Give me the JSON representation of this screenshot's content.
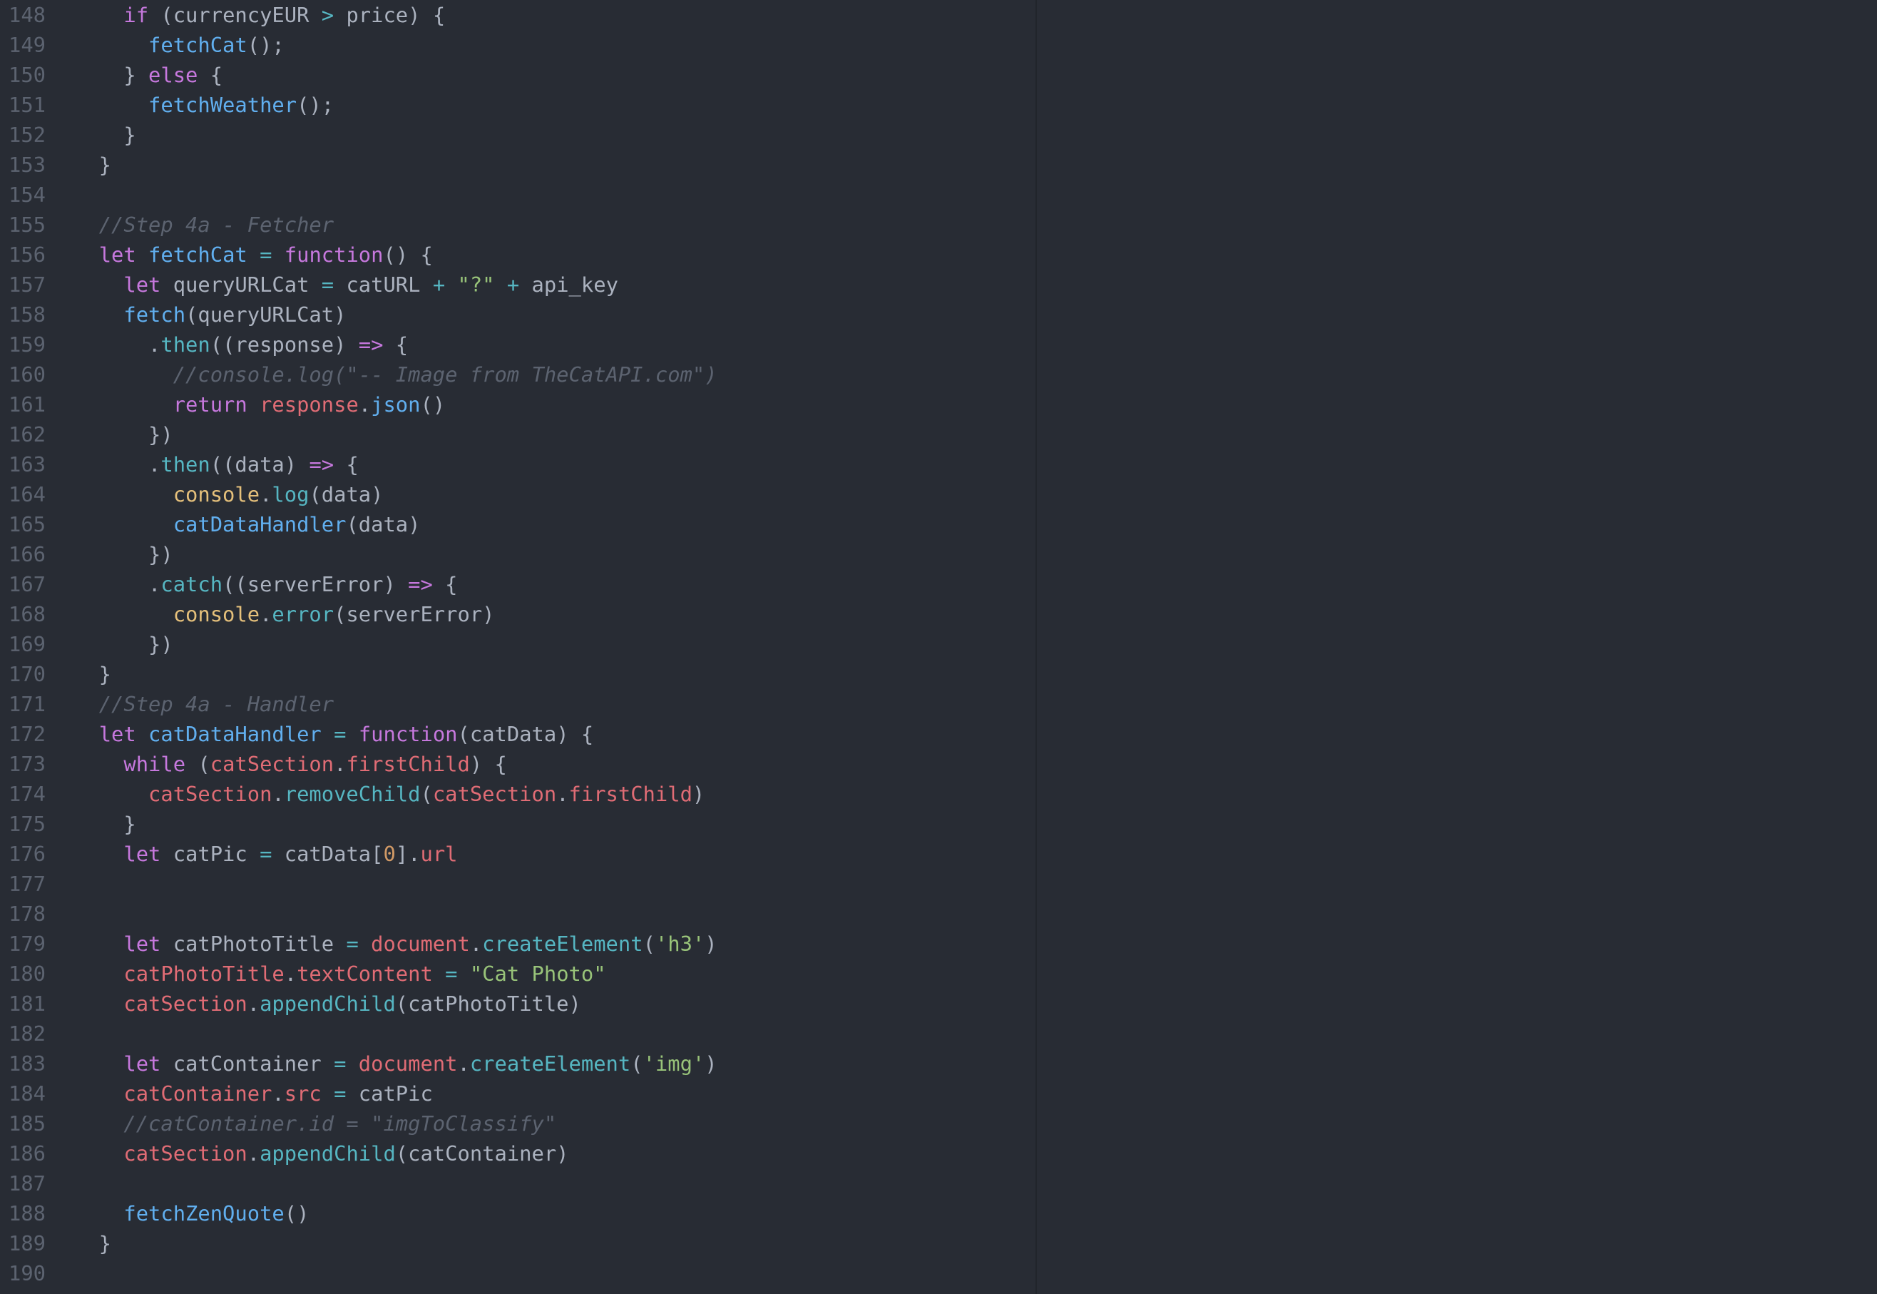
{
  "editor": {
    "lines": [
      {
        "num": "148",
        "tokens": [
          {
            "t": "    "
          },
          {
            "t": "if",
            "c": "kw"
          },
          {
            "t": " (currencyEUR "
          },
          {
            "t": ">",
            "c": "op"
          },
          {
            "t": " price) {"
          }
        ]
      },
      {
        "num": "149",
        "tokens": [
          {
            "t": "      "
          },
          {
            "t": "fetchCat",
            "c": "fn"
          },
          {
            "t": "();"
          }
        ]
      },
      {
        "num": "150",
        "tokens": [
          {
            "t": "    } "
          },
          {
            "t": "else",
            "c": "kw"
          },
          {
            "t": " {"
          }
        ]
      },
      {
        "num": "151",
        "tokens": [
          {
            "t": "      "
          },
          {
            "t": "fetchWeather",
            "c": "fn"
          },
          {
            "t": "();"
          }
        ]
      },
      {
        "num": "152",
        "tokens": [
          {
            "t": "    }"
          }
        ]
      },
      {
        "num": "153",
        "tokens": [
          {
            "t": "  }"
          }
        ]
      },
      {
        "num": "154",
        "tokens": []
      },
      {
        "num": "155",
        "tokens": [
          {
            "t": "  "
          },
          {
            "t": "//Step 4a - Fetcher",
            "c": "comment"
          }
        ]
      },
      {
        "num": "156",
        "tokens": [
          {
            "t": "  "
          },
          {
            "t": "let",
            "c": "kw"
          },
          {
            "t": " "
          },
          {
            "t": "fetchCat",
            "c": "fn"
          },
          {
            "t": " "
          },
          {
            "t": "=",
            "c": "op"
          },
          {
            "t": " "
          },
          {
            "t": "function",
            "c": "kw"
          },
          {
            "t": "() {"
          }
        ]
      },
      {
        "num": "157",
        "tokens": [
          {
            "t": "    "
          },
          {
            "t": "let",
            "c": "kw"
          },
          {
            "t": " queryURLCat "
          },
          {
            "t": "=",
            "c": "op"
          },
          {
            "t": " catURL "
          },
          {
            "t": "+",
            "c": "op"
          },
          {
            "t": " "
          },
          {
            "t": "\"?\"",
            "c": "str"
          },
          {
            "t": " "
          },
          {
            "t": "+",
            "c": "op"
          },
          {
            "t": " api_key"
          }
        ]
      },
      {
        "num": "158",
        "tokens": [
          {
            "t": "    "
          },
          {
            "t": "fetch",
            "c": "fn"
          },
          {
            "t": "(queryURLCat)"
          }
        ]
      },
      {
        "num": "159",
        "tokens": [
          {
            "t": "      ."
          },
          {
            "t": "then",
            "c": "method"
          },
          {
            "t": "((response) "
          },
          {
            "t": "=>",
            "c": "kw"
          },
          {
            "t": " {"
          }
        ]
      },
      {
        "num": "160",
        "tokens": [
          {
            "t": "        "
          },
          {
            "t": "//console.log(\"-- Image from TheCatAPI.com\")",
            "c": "comment"
          }
        ]
      },
      {
        "num": "161",
        "tokens": [
          {
            "t": "        "
          },
          {
            "t": "return",
            "c": "kw"
          },
          {
            "t": " "
          },
          {
            "t": "response",
            "c": "prop"
          },
          {
            "t": "."
          },
          {
            "t": "json",
            "c": "fn"
          },
          {
            "t": "()"
          }
        ]
      },
      {
        "num": "162",
        "tokens": [
          {
            "t": "      })"
          }
        ]
      },
      {
        "num": "163",
        "tokens": [
          {
            "t": "      ."
          },
          {
            "t": "then",
            "c": "method"
          },
          {
            "t": "((data) "
          },
          {
            "t": "=>",
            "c": "kw"
          },
          {
            "t": " {"
          }
        ]
      },
      {
        "num": "164",
        "tokens": [
          {
            "t": "        "
          },
          {
            "t": "console",
            "c": "obj"
          },
          {
            "t": "."
          },
          {
            "t": "log",
            "c": "method"
          },
          {
            "t": "(data)"
          }
        ]
      },
      {
        "num": "165",
        "tokens": [
          {
            "t": "        "
          },
          {
            "t": "catDataHandler",
            "c": "fn"
          },
          {
            "t": "(data)"
          }
        ]
      },
      {
        "num": "166",
        "tokens": [
          {
            "t": "      })"
          }
        ]
      },
      {
        "num": "167",
        "tokens": [
          {
            "t": "      ."
          },
          {
            "t": "catch",
            "c": "method"
          },
          {
            "t": "((serverError) "
          },
          {
            "t": "=>",
            "c": "kw"
          },
          {
            "t": " {"
          }
        ]
      },
      {
        "num": "168",
        "tokens": [
          {
            "t": "        "
          },
          {
            "t": "console",
            "c": "obj"
          },
          {
            "t": "."
          },
          {
            "t": "error",
            "c": "method"
          },
          {
            "t": "(serverError)"
          }
        ]
      },
      {
        "num": "169",
        "tokens": [
          {
            "t": "      })"
          }
        ]
      },
      {
        "num": "170",
        "tokens": [
          {
            "t": "  }"
          }
        ]
      },
      {
        "num": "171",
        "tokens": [
          {
            "t": "  "
          },
          {
            "t": "//Step 4a - Handler",
            "c": "comment"
          }
        ]
      },
      {
        "num": "172",
        "tokens": [
          {
            "t": "  "
          },
          {
            "t": "let",
            "c": "kw"
          },
          {
            "t": " "
          },
          {
            "t": "catDataHandler",
            "c": "fn"
          },
          {
            "t": " "
          },
          {
            "t": "=",
            "c": "op"
          },
          {
            "t": " "
          },
          {
            "t": "function",
            "c": "kw"
          },
          {
            "t": "(catData) {"
          }
        ]
      },
      {
        "num": "173",
        "tokens": [
          {
            "t": "    "
          },
          {
            "t": "while",
            "c": "kw"
          },
          {
            "t": " ("
          },
          {
            "t": "catSection",
            "c": "prop"
          },
          {
            "t": "."
          },
          {
            "t": "firstChild",
            "c": "prop"
          },
          {
            "t": ") {"
          }
        ]
      },
      {
        "num": "174",
        "tokens": [
          {
            "t": "      "
          },
          {
            "t": "catSection",
            "c": "prop"
          },
          {
            "t": "."
          },
          {
            "t": "removeChild",
            "c": "method"
          },
          {
            "t": "("
          },
          {
            "t": "catSection",
            "c": "prop"
          },
          {
            "t": "."
          },
          {
            "t": "firstChild",
            "c": "prop"
          },
          {
            "t": ")"
          }
        ]
      },
      {
        "num": "175",
        "tokens": [
          {
            "t": "    }"
          }
        ]
      },
      {
        "num": "176",
        "tokens": [
          {
            "t": "    "
          },
          {
            "t": "let",
            "c": "kw"
          },
          {
            "t": " catPic "
          },
          {
            "t": "=",
            "c": "op"
          },
          {
            "t": " catData["
          },
          {
            "t": "0",
            "c": "num"
          },
          {
            "t": "]."
          },
          {
            "t": "url",
            "c": "prop"
          }
        ]
      },
      {
        "num": "177",
        "tokens": []
      },
      {
        "num": "178",
        "tokens": []
      },
      {
        "num": "179",
        "tokens": [
          {
            "t": "    "
          },
          {
            "t": "let",
            "c": "kw"
          },
          {
            "t": " catPhotoTitle "
          },
          {
            "t": "=",
            "c": "op"
          },
          {
            "t": " "
          },
          {
            "t": "document",
            "c": "prop"
          },
          {
            "t": "."
          },
          {
            "t": "createElement",
            "c": "method"
          },
          {
            "t": "("
          },
          {
            "t": "'h3'",
            "c": "str"
          },
          {
            "t": ")"
          }
        ]
      },
      {
        "num": "180",
        "tokens": [
          {
            "t": "    "
          },
          {
            "t": "catPhotoTitle",
            "c": "prop"
          },
          {
            "t": "."
          },
          {
            "t": "textContent",
            "c": "prop"
          },
          {
            "t": " "
          },
          {
            "t": "=",
            "c": "op"
          },
          {
            "t": " "
          },
          {
            "t": "\"Cat Photo\"",
            "c": "str"
          }
        ]
      },
      {
        "num": "181",
        "tokens": [
          {
            "t": "    "
          },
          {
            "t": "catSection",
            "c": "prop"
          },
          {
            "t": "."
          },
          {
            "t": "appendChild",
            "c": "method"
          },
          {
            "t": "(catPhotoTitle)"
          }
        ]
      },
      {
        "num": "182",
        "tokens": []
      },
      {
        "num": "183",
        "tokens": [
          {
            "t": "    "
          },
          {
            "t": "let",
            "c": "kw"
          },
          {
            "t": " catContainer "
          },
          {
            "t": "=",
            "c": "op"
          },
          {
            "t": " "
          },
          {
            "t": "document",
            "c": "prop"
          },
          {
            "t": "."
          },
          {
            "t": "createElement",
            "c": "method"
          },
          {
            "t": "("
          },
          {
            "t": "'img'",
            "c": "str"
          },
          {
            "t": ")"
          }
        ]
      },
      {
        "num": "184",
        "tokens": [
          {
            "t": "    "
          },
          {
            "t": "catContainer",
            "c": "prop"
          },
          {
            "t": "."
          },
          {
            "t": "src",
            "c": "prop"
          },
          {
            "t": " "
          },
          {
            "t": "=",
            "c": "op"
          },
          {
            "t": " catPic"
          }
        ]
      },
      {
        "num": "185",
        "tokens": [
          {
            "t": "    "
          },
          {
            "t": "//catContainer.id = \"imgToClassify\"",
            "c": "comment"
          }
        ]
      },
      {
        "num": "186",
        "tokens": [
          {
            "t": "    "
          },
          {
            "t": "catSection",
            "c": "prop"
          },
          {
            "t": "."
          },
          {
            "t": "appendChild",
            "c": "method"
          },
          {
            "t": "(catContainer)"
          }
        ]
      },
      {
        "num": "187",
        "tokens": []
      },
      {
        "num": "188",
        "tokens": [
          {
            "t": "    "
          },
          {
            "t": "fetchZenQuote",
            "c": "fn"
          },
          {
            "t": "()"
          }
        ]
      },
      {
        "num": "189",
        "tokens": [
          {
            "t": "  }"
          }
        ]
      },
      {
        "num": "190",
        "tokens": []
      }
    ]
  },
  "colors": {
    "background": "#282c34",
    "gutter_text": "#5c6370",
    "plain": "#abb2bf",
    "keyword": "#c678dd",
    "function": "#61afef",
    "property": "#e06c75",
    "string": "#98c379",
    "number": "#d19a66",
    "operator": "#56b6c2",
    "object": "#e5c07b",
    "comment": "#5c6370"
  }
}
